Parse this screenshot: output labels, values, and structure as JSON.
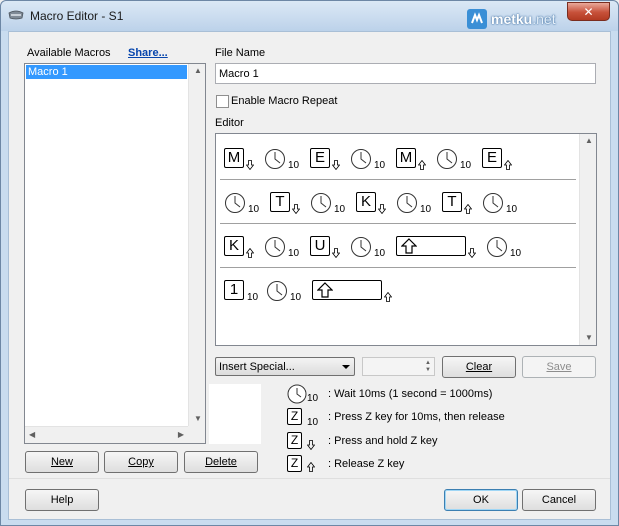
{
  "window": {
    "title": "Macro Editor - S1",
    "brand": "metku",
    "brand_tld": ".net",
    "close_glyph": "✕"
  },
  "left": {
    "available_label": "Available Macros",
    "share_link": "Share...",
    "macros": [
      "Macro 1"
    ],
    "selected_index": 0,
    "new_label": "New",
    "copy_label": "Copy",
    "delete_label": "Delete"
  },
  "right": {
    "file_name_label": "File Name",
    "file_name_value": "Macro 1",
    "repeat_label": "Enable Macro Repeat",
    "repeat_checked": false,
    "editor_label": "Editor"
  },
  "editor": {
    "rows": [
      [
        {
          "type": "key",
          "label": "M",
          "dir": "down"
        },
        {
          "type": "wait",
          "ms": "10"
        },
        {
          "type": "key",
          "label": "E",
          "dir": "down"
        },
        {
          "type": "wait",
          "ms": "10"
        },
        {
          "type": "key",
          "label": "M",
          "dir": "up"
        },
        {
          "type": "wait",
          "ms": "10"
        },
        {
          "type": "key",
          "label": "E",
          "dir": "up"
        }
      ],
      [
        {
          "type": "wait",
          "ms": "10"
        },
        {
          "type": "key",
          "label": "T",
          "dir": "down"
        },
        {
          "type": "wait",
          "ms": "10"
        },
        {
          "type": "key",
          "label": "K",
          "dir": "down"
        },
        {
          "type": "wait",
          "ms": "10"
        },
        {
          "type": "key",
          "label": "T",
          "dir": "up"
        },
        {
          "type": "wait",
          "ms": "10"
        }
      ],
      [
        {
          "type": "key",
          "label": "K",
          "dir": "up"
        },
        {
          "type": "wait",
          "ms": "10"
        },
        {
          "type": "key",
          "label": "U",
          "dir": "down"
        },
        {
          "type": "wait",
          "ms": "10"
        },
        {
          "type": "key",
          "label": "shift",
          "dir": "down",
          "wide": true
        },
        {
          "type": "wait",
          "ms": "10"
        }
      ],
      [
        {
          "type": "key",
          "label": "1",
          "dir": "tap",
          "ms": "10"
        },
        {
          "type": "wait",
          "ms": "10"
        },
        {
          "type": "key",
          "label": "shift",
          "dir": "up",
          "wide": true
        }
      ]
    ]
  },
  "controls": {
    "insert_special": "Insert Special...",
    "clear_label": "Clear",
    "save_label": "Save"
  },
  "legend": {
    "wait_num": "10",
    "wait_text": ": Wait 10ms (1 second = 1000ms)",
    "tap_key": "Z",
    "tap_num": "10",
    "tap_text": ": Press Z key for 10ms, then release",
    "down_key": "Z",
    "down_text": ": Press and hold Z key",
    "up_key": "Z",
    "up_text": ": Release Z key"
  },
  "footer": {
    "help_label": "Help",
    "ok_label": "OK",
    "cancel_label": "Cancel"
  },
  "colors": {
    "selection": "#3399ff",
    "link": "#0645ad",
    "close_button": "#c7513a"
  }
}
